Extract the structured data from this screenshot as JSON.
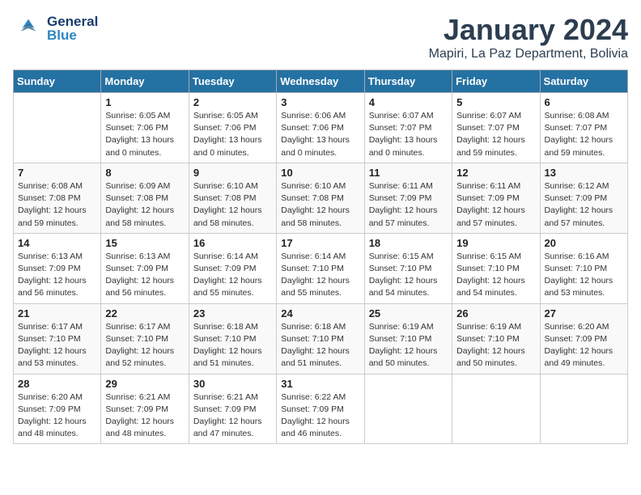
{
  "logo": {
    "general": "General",
    "blue": "Blue"
  },
  "header": {
    "month": "January 2024",
    "location": "Mapiri, La Paz Department, Bolivia"
  },
  "days_of_week": [
    "Sunday",
    "Monday",
    "Tuesday",
    "Wednesday",
    "Thursday",
    "Friday",
    "Saturday"
  ],
  "weeks": [
    [
      {
        "day": "",
        "info": ""
      },
      {
        "day": "1",
        "info": "Sunrise: 6:05 AM\nSunset: 7:06 PM\nDaylight: 13 hours\nand 0 minutes."
      },
      {
        "day": "2",
        "info": "Sunrise: 6:05 AM\nSunset: 7:06 PM\nDaylight: 13 hours\nand 0 minutes."
      },
      {
        "day": "3",
        "info": "Sunrise: 6:06 AM\nSunset: 7:06 PM\nDaylight: 13 hours\nand 0 minutes."
      },
      {
        "day": "4",
        "info": "Sunrise: 6:07 AM\nSunset: 7:07 PM\nDaylight: 13 hours\nand 0 minutes."
      },
      {
        "day": "5",
        "info": "Sunrise: 6:07 AM\nSunset: 7:07 PM\nDaylight: 12 hours\nand 59 minutes."
      },
      {
        "day": "6",
        "info": "Sunrise: 6:08 AM\nSunset: 7:07 PM\nDaylight: 12 hours\nand 59 minutes."
      }
    ],
    [
      {
        "day": "7",
        "info": "Sunrise: 6:08 AM\nSunset: 7:08 PM\nDaylight: 12 hours\nand 59 minutes."
      },
      {
        "day": "8",
        "info": "Sunrise: 6:09 AM\nSunset: 7:08 PM\nDaylight: 12 hours\nand 58 minutes."
      },
      {
        "day": "9",
        "info": "Sunrise: 6:10 AM\nSunset: 7:08 PM\nDaylight: 12 hours\nand 58 minutes."
      },
      {
        "day": "10",
        "info": "Sunrise: 6:10 AM\nSunset: 7:08 PM\nDaylight: 12 hours\nand 58 minutes."
      },
      {
        "day": "11",
        "info": "Sunrise: 6:11 AM\nSunset: 7:09 PM\nDaylight: 12 hours\nand 57 minutes."
      },
      {
        "day": "12",
        "info": "Sunrise: 6:11 AM\nSunset: 7:09 PM\nDaylight: 12 hours\nand 57 minutes."
      },
      {
        "day": "13",
        "info": "Sunrise: 6:12 AM\nSunset: 7:09 PM\nDaylight: 12 hours\nand 57 minutes."
      }
    ],
    [
      {
        "day": "14",
        "info": "Sunrise: 6:13 AM\nSunset: 7:09 PM\nDaylight: 12 hours\nand 56 minutes."
      },
      {
        "day": "15",
        "info": "Sunrise: 6:13 AM\nSunset: 7:09 PM\nDaylight: 12 hours\nand 56 minutes."
      },
      {
        "day": "16",
        "info": "Sunrise: 6:14 AM\nSunset: 7:09 PM\nDaylight: 12 hours\nand 55 minutes."
      },
      {
        "day": "17",
        "info": "Sunrise: 6:14 AM\nSunset: 7:10 PM\nDaylight: 12 hours\nand 55 minutes."
      },
      {
        "day": "18",
        "info": "Sunrise: 6:15 AM\nSunset: 7:10 PM\nDaylight: 12 hours\nand 54 minutes."
      },
      {
        "day": "19",
        "info": "Sunrise: 6:15 AM\nSunset: 7:10 PM\nDaylight: 12 hours\nand 54 minutes."
      },
      {
        "day": "20",
        "info": "Sunrise: 6:16 AM\nSunset: 7:10 PM\nDaylight: 12 hours\nand 53 minutes."
      }
    ],
    [
      {
        "day": "21",
        "info": "Sunrise: 6:17 AM\nSunset: 7:10 PM\nDaylight: 12 hours\nand 53 minutes."
      },
      {
        "day": "22",
        "info": "Sunrise: 6:17 AM\nSunset: 7:10 PM\nDaylight: 12 hours\nand 52 minutes."
      },
      {
        "day": "23",
        "info": "Sunrise: 6:18 AM\nSunset: 7:10 PM\nDaylight: 12 hours\nand 51 minutes."
      },
      {
        "day": "24",
        "info": "Sunrise: 6:18 AM\nSunset: 7:10 PM\nDaylight: 12 hours\nand 51 minutes."
      },
      {
        "day": "25",
        "info": "Sunrise: 6:19 AM\nSunset: 7:10 PM\nDaylight: 12 hours\nand 50 minutes."
      },
      {
        "day": "26",
        "info": "Sunrise: 6:19 AM\nSunset: 7:10 PM\nDaylight: 12 hours\nand 50 minutes."
      },
      {
        "day": "27",
        "info": "Sunrise: 6:20 AM\nSunset: 7:09 PM\nDaylight: 12 hours\nand 49 minutes."
      }
    ],
    [
      {
        "day": "28",
        "info": "Sunrise: 6:20 AM\nSunset: 7:09 PM\nDaylight: 12 hours\nand 48 minutes."
      },
      {
        "day": "29",
        "info": "Sunrise: 6:21 AM\nSunset: 7:09 PM\nDaylight: 12 hours\nand 48 minutes."
      },
      {
        "day": "30",
        "info": "Sunrise: 6:21 AM\nSunset: 7:09 PM\nDaylight: 12 hours\nand 47 minutes."
      },
      {
        "day": "31",
        "info": "Sunrise: 6:22 AM\nSunset: 7:09 PM\nDaylight: 12 hours\nand 46 minutes."
      },
      {
        "day": "",
        "info": ""
      },
      {
        "day": "",
        "info": ""
      },
      {
        "day": "",
        "info": ""
      }
    ]
  ]
}
